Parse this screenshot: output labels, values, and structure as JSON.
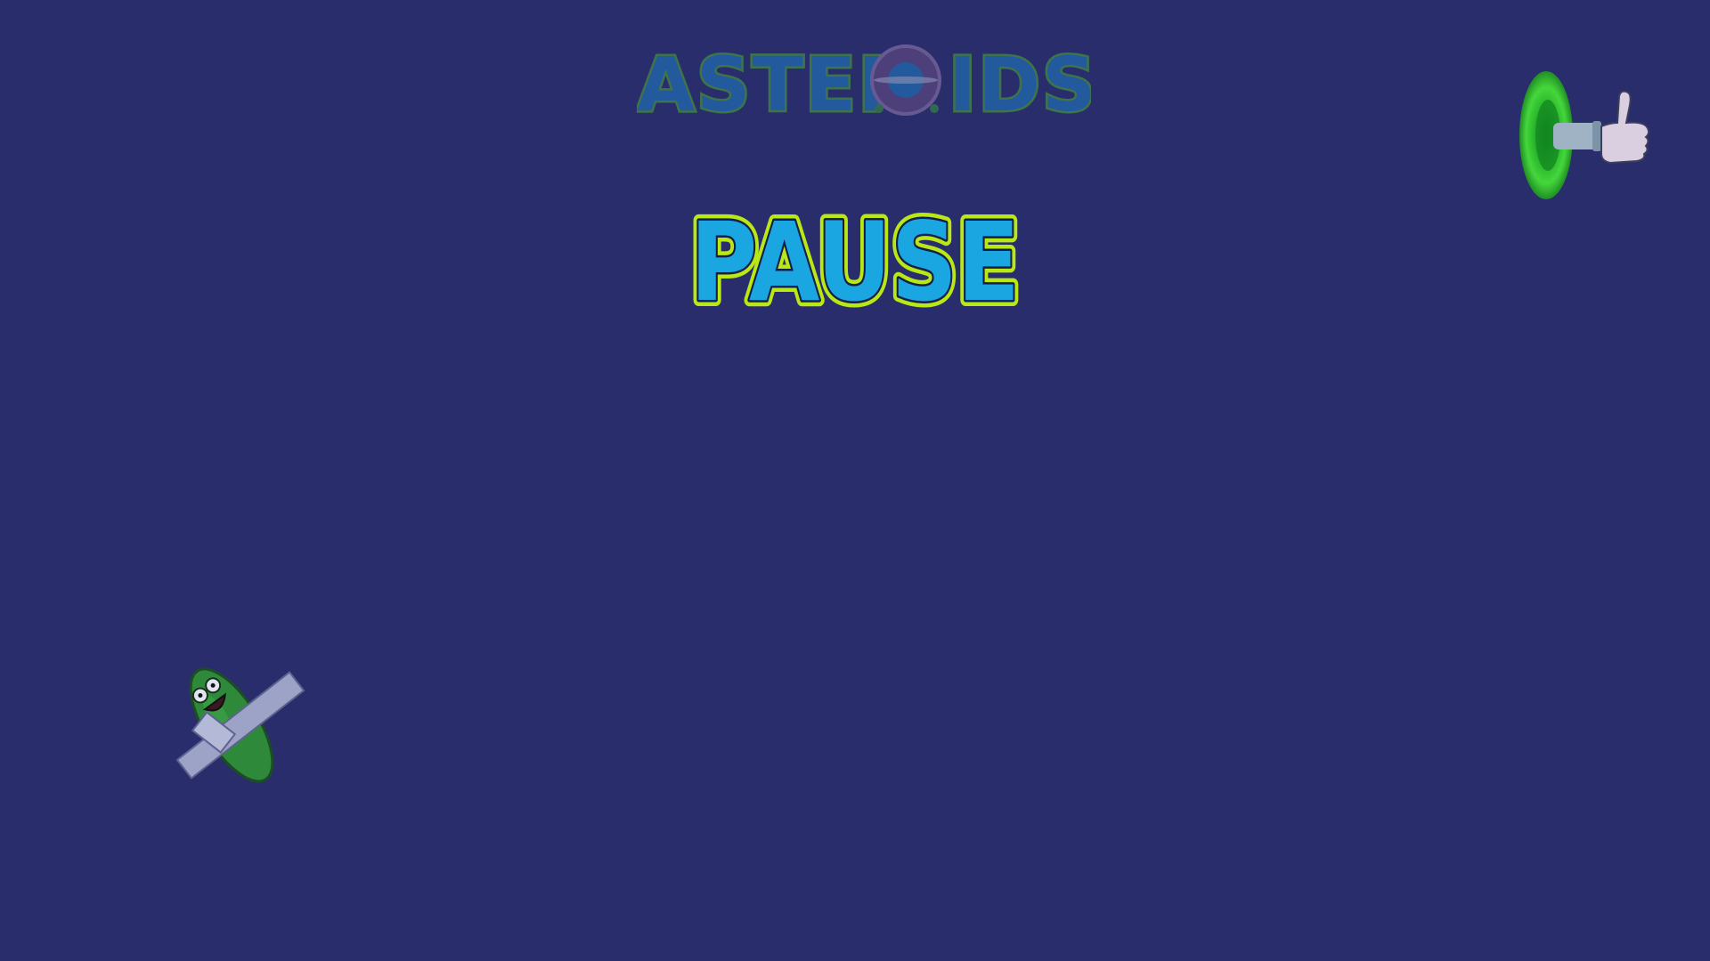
{
  "game": {
    "logo_text": "ASTER",
    "logo_text_tail": "IDS",
    "status_title": "PAUSE"
  },
  "colors": {
    "background": "#2a2d6b",
    "pause_fill": "#1aa6e0",
    "pause_outline": "#b8e816",
    "logo_fill": "#1e7fc7",
    "logo_outline": "#4fae2e",
    "portal_green": "#2fc42f"
  },
  "icons": {
    "logo_o": "planet-ring-icon",
    "top_right": "portal-thumbs-up-icon",
    "bottom_left": "taped-pickle-icon"
  }
}
